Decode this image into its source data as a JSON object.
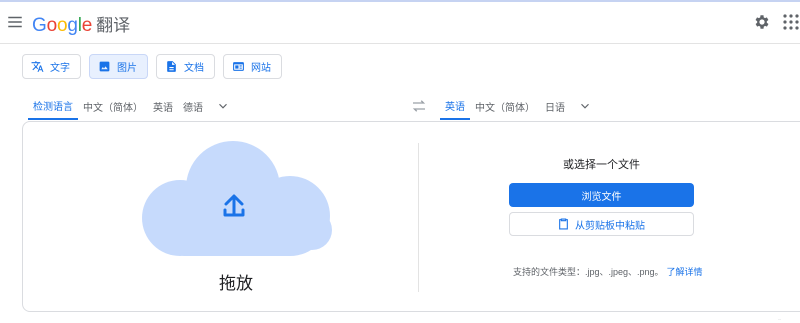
{
  "header": {
    "logo_letters": [
      {
        "ch": "G",
        "color": "#4285F4"
      },
      {
        "ch": "o",
        "color": "#EA4335"
      },
      {
        "ch": "o",
        "color": "#FBBC05"
      },
      {
        "ch": "g",
        "color": "#4285F4"
      },
      {
        "ch": "l",
        "color": "#34A853"
      },
      {
        "ch": "e",
        "color": "#EA4335"
      }
    ],
    "product": "翻译",
    "icons": [
      "menu-icon",
      "settings-icon",
      "apps-icon"
    ]
  },
  "modes": [
    {
      "label": "文字",
      "icon": "translate-icon",
      "active": false
    },
    {
      "label": "图片",
      "icon": "image-icon",
      "active": true
    },
    {
      "label": "文档",
      "icon": "document-icon",
      "active": false
    },
    {
      "label": "网站",
      "icon": "website-icon",
      "active": false
    }
  ],
  "source_langs": {
    "items": [
      "检测语言",
      "中文（简体）",
      "英语",
      "德语"
    ],
    "selected": "检测语言"
  },
  "target_langs": {
    "items": [
      "英语",
      "中文（简体）",
      "日语"
    ],
    "selected": "英语"
  },
  "upload": {
    "drop_label": "拖放",
    "or_choose": "或选择一个文件",
    "browse_label": "浏览文件",
    "paste_label": "从剪贴板中粘贴",
    "supported_text": "支持的文件类型：.jpg、.jpeg、.png。",
    "learn_more": "了解详情"
  },
  "corner_text": "...",
  "colors": {
    "accent": "#1a73e8",
    "cloud": "#c6dafc",
    "active_tab_bg": "#e8f0fe"
  }
}
